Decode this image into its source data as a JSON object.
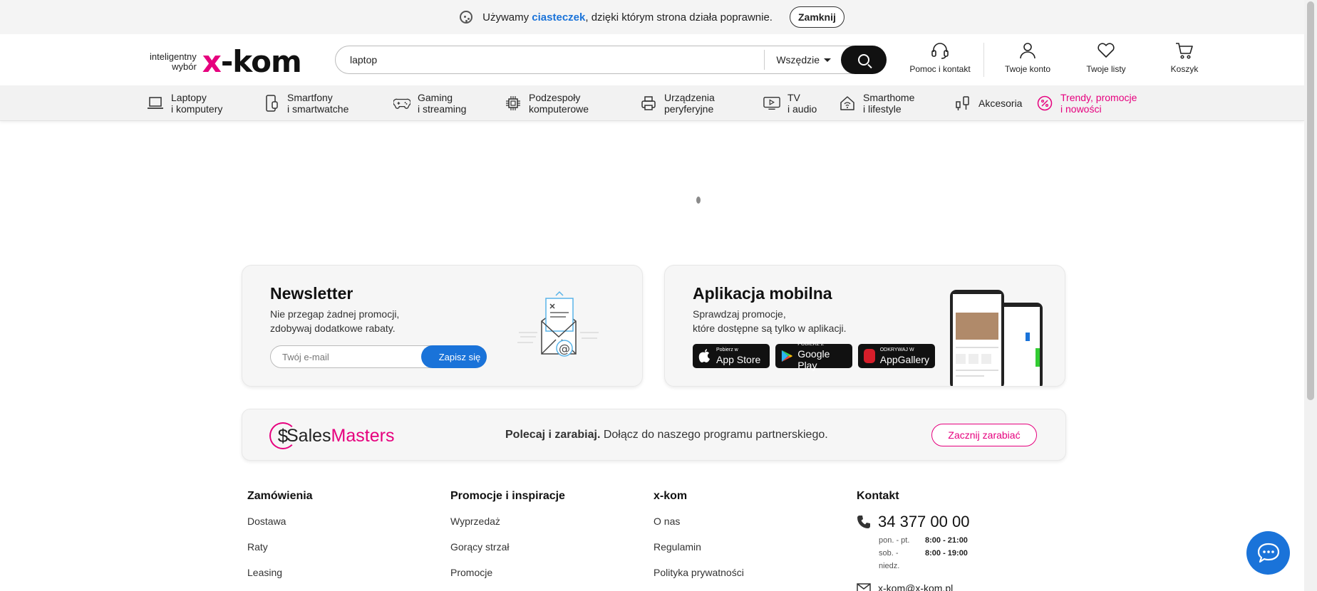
{
  "cookie_bar": {
    "text_before": "Używamy",
    "link": "ciasteczek",
    "text_after": ", dzięki którym strona działa poprawnie.",
    "close_label": "Zamknij"
  },
  "header": {
    "logo_tagline_1": "inteligentny",
    "logo_tagline_2": "wybór",
    "logo_word_x": "x",
    "logo_word_rest": "-kom",
    "search_value": "laptop",
    "search_scope": "Wszędzie",
    "actions": [
      {
        "label": "Pomoc i kontakt",
        "icon": "headset-icon"
      },
      {
        "label": "Twoje konto",
        "icon": "user-icon"
      },
      {
        "label": "Twoje listy",
        "icon": "heart-icon"
      },
      {
        "label": "Koszyk",
        "icon": "cart-icon"
      }
    ]
  },
  "categories": [
    {
      "line1": "Laptopy",
      "line2": "i komputery",
      "icon": "laptop-icon"
    },
    {
      "line1": "Smartfony",
      "line2": "i smartwatche",
      "icon": "smartphone-icon"
    },
    {
      "line1": "Gaming",
      "line2": "i streaming",
      "icon": "gamepad-icon"
    },
    {
      "line1": "Podzespoły",
      "line2": "komputerowe",
      "icon": "cpu-icon"
    },
    {
      "line1": "Urządzenia",
      "line2": "peryferyjne",
      "icon": "printer-icon"
    },
    {
      "line1": "TV",
      "line2": "i audio",
      "icon": "tv-icon"
    },
    {
      "line1": "Smarthome",
      "line2": "i lifestyle",
      "icon": "smarthome-icon"
    },
    {
      "line1": "Akcesoria",
      "line2": "",
      "icon": "accessories-icon"
    },
    {
      "line1": "Trendy, promocje",
      "line2": "i nowości",
      "icon": "percent-icon"
    }
  ],
  "newsletter": {
    "title": "Newsletter",
    "line1": "Nie przegap żadnej promocji,",
    "line2": "zdobywaj dodatkowe rabaty.",
    "email_placeholder": "Twój e-mail",
    "subscribe_label": "Zapisz się"
  },
  "app": {
    "title": "Aplikacja mobilna",
    "line1": "Sprawdzaj promocje,",
    "line2": "które dostępne są tylko w aplikacji.",
    "stores": [
      {
        "small": "Pobierz w",
        "big": "App Store"
      },
      {
        "small": "POBIERZ Z",
        "big": "Google Play"
      },
      {
        "small": "ODKRYWAJ W",
        "big": "AppGallery"
      }
    ]
  },
  "salesmasters": {
    "logo_first": "Sales",
    "logo_second": "Masters",
    "bold": "Polecaj i zarabiaj.",
    "text": " Dołącz do naszego programu partnerskiego.",
    "button": "Zacznij zarabiać"
  },
  "footer": {
    "col1": {
      "title": "Zamówienia",
      "links": [
        "Dostawa",
        "Raty",
        "Leasing"
      ]
    },
    "col2": {
      "title": "Promocje i inspiracje",
      "links": [
        "Wyprzedaż",
        "Gorący strzał",
        "Promocje"
      ]
    },
    "col3": {
      "title": "x-kom",
      "links": [
        "O nas",
        "Regulamin",
        "Polityka prywatności"
      ]
    },
    "contact": {
      "title": "Kontakt",
      "phone": "34 377 00 00",
      "hours": [
        {
          "days": "pon. - pt.",
          "time": "8:00 - 21:00"
        },
        {
          "days": "sob. - niedz.",
          "time": "8:00 - 19:00"
        }
      ],
      "email": "x-kom@x-kom.pl"
    }
  },
  "colors": {
    "accent": "#e6007e",
    "blue": "#1a73d9"
  }
}
